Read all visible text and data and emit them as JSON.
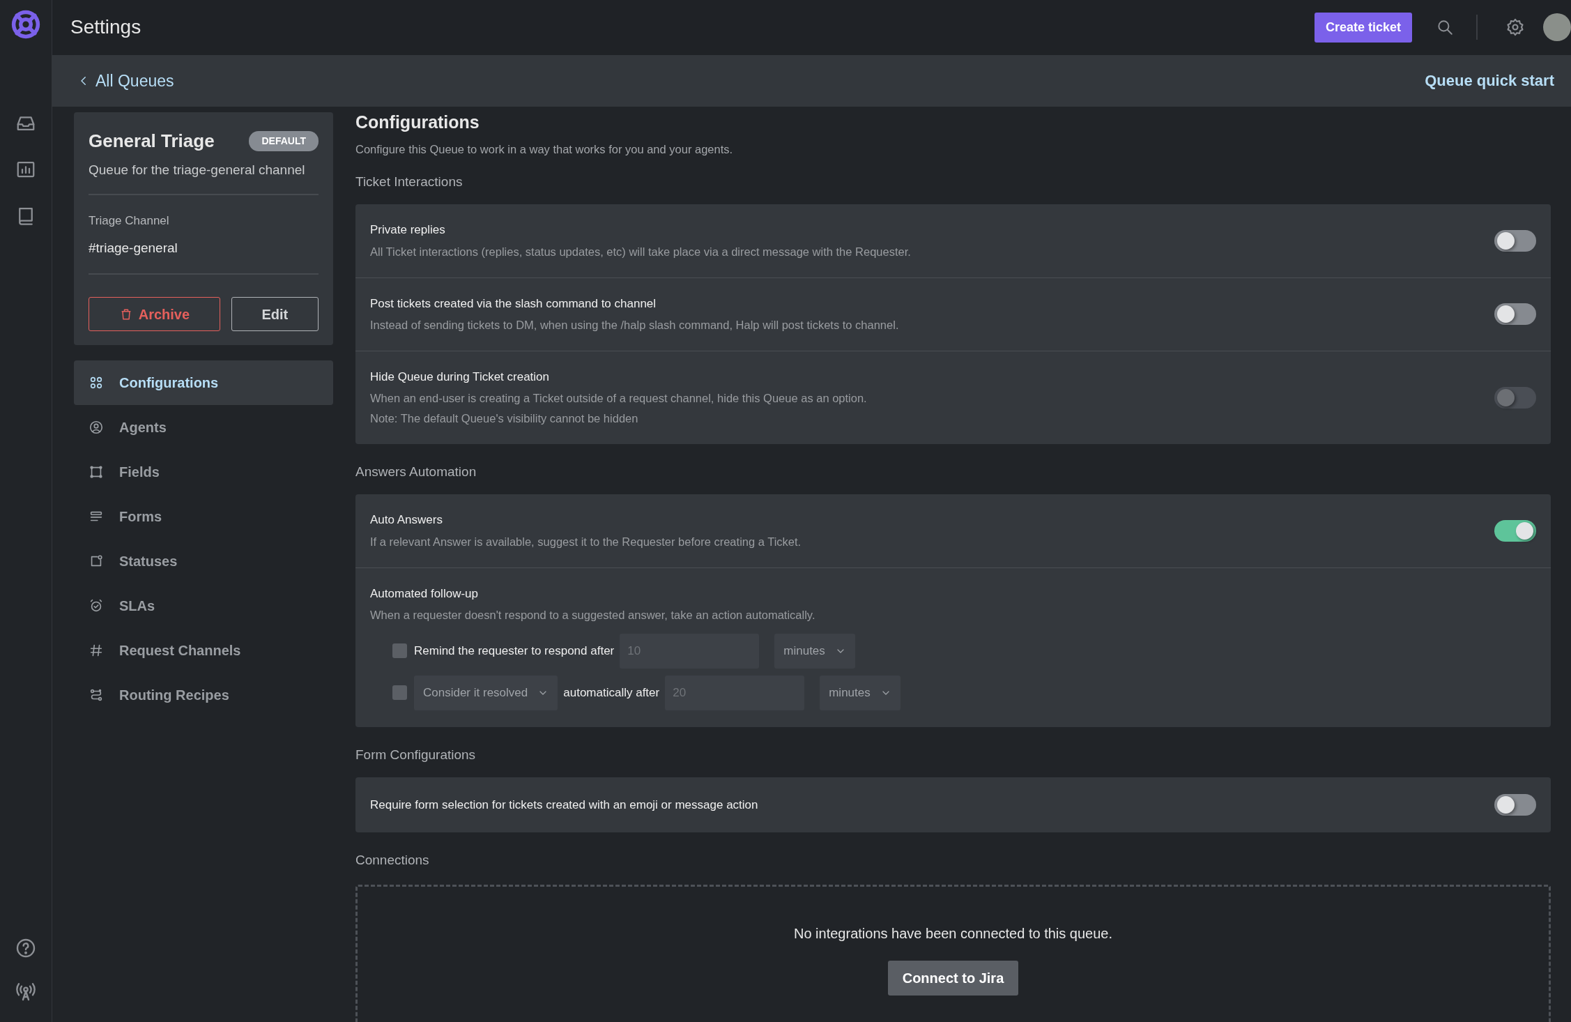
{
  "app_bar": {
    "title": "Settings",
    "create_button": "Create ticket"
  },
  "breadcrumb": {
    "back": "All Queues",
    "quick_start": "Queue quick start"
  },
  "queue": {
    "name": "General Triage",
    "badge": "DEFAULT",
    "description": "Queue for the triage-general channel",
    "channel_label": "Triage Channel",
    "channel": "#triage-general",
    "archive_button": "Archive",
    "edit_button": "Edit"
  },
  "nav": [
    {
      "label": "Configurations",
      "selected": true
    },
    {
      "label": "Agents",
      "selected": false
    },
    {
      "label": "Fields",
      "selected": false
    },
    {
      "label": "Forms",
      "selected": false
    },
    {
      "label": "Statuses",
      "selected": false
    },
    {
      "label": "SLAs",
      "selected": false
    },
    {
      "label": "Request Channels",
      "selected": false
    },
    {
      "label": "Routing Recipes",
      "selected": false
    }
  ],
  "page": {
    "title": "Configurations",
    "subtitle": "Configure this Queue to work in a way that works for you and your agents."
  },
  "sections": [
    {
      "heading": "Ticket Interactions",
      "settings": [
        {
          "kind": "toggle",
          "title": "Private replies",
          "description": "All Ticket interactions (replies, status updates, etc) will take place via a direct message with the Requester.",
          "on": false,
          "disabled": false
        },
        {
          "kind": "toggle",
          "title": "Post tickets created via the slash command to channel",
          "description": "Instead of sending tickets to DM, when using the /halp slash command, Halp will post tickets to channel.",
          "on": false,
          "disabled": false
        },
        {
          "kind": "toggle",
          "title": "Hide Queue during Ticket creation",
          "description": "When an end-user is creating a Ticket outside of a request channel, hide this Queue as an option.",
          "note": "Note: The default Queue's visibility cannot be hidden",
          "on": false,
          "disabled": true
        }
      ]
    },
    {
      "heading": "Answers Automation",
      "settings": [
        {
          "kind": "toggle",
          "title": "Auto Answers",
          "description": "If a relevant Answer is available, suggest it to the Requester before creating a Ticket.",
          "on": true,
          "disabled": false
        },
        {
          "kind": "followup",
          "title": "Automated follow-up",
          "description": "When a requester doesn't respond to a suggested answer, take an action automatically.",
          "rules": [
            {
              "checked": false,
              "label": "Remind the requester to respond after",
              "placeholder": "10",
              "unit": "minutes"
            },
            {
              "checked": false,
              "action": "Consider it resolved",
              "label": "automatically after",
              "placeholder": "20",
              "unit": "minutes"
            }
          ]
        }
      ]
    },
    {
      "heading": "Form Configurations",
      "settings": [
        {
          "kind": "toggle",
          "title": "Require form selection for tickets created with an emoji or message action",
          "on": false,
          "disabled": false
        }
      ]
    }
  ],
  "connections": {
    "heading": "Connections",
    "empty_text": "No integrations have been connected to this queue.",
    "button": "Connect to Jira"
  }
}
